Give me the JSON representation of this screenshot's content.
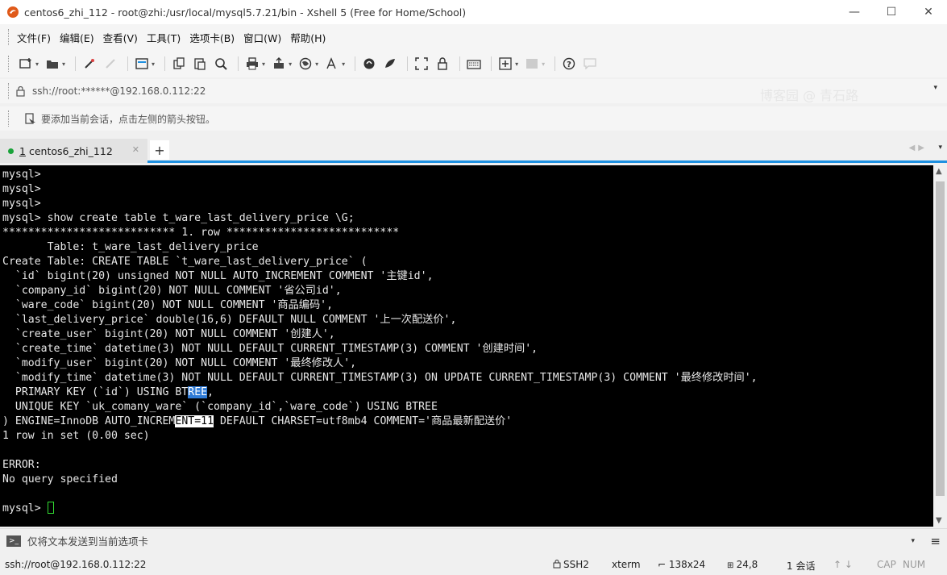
{
  "window": {
    "title": "centos6_zhi_112 - root@zhi:/usr/local/mysql5.7.21/bin - Xshell 5 (Free for Home/School)",
    "controls": {
      "minimize": "—",
      "maximize": "☐",
      "close": "✕"
    }
  },
  "menu": {
    "items": [
      "文件(F)",
      "编辑(E)",
      "查看(V)",
      "工具(T)",
      "选项卡(B)",
      "窗口(W)",
      "帮助(H)"
    ]
  },
  "address": {
    "value": "ssh://root:******@192.168.0.112:22",
    "watermark": "博客园 @ 青石路"
  },
  "hint": {
    "text": "要添加当前会话，点击左侧的箭头按钮。"
  },
  "tabs": {
    "active": {
      "number": "1",
      "label": "centos6_zhi_112"
    },
    "add": "+"
  },
  "terminal": {
    "lines": [
      "mysql>",
      "mysql>",
      "mysql>",
      "mysql> show create table t_ware_last_delivery_price \\G;",
      "*************************** 1. row ***************************",
      "       Table: t_ware_last_delivery_price",
      "Create Table: CREATE TABLE `t_ware_last_delivery_price` (",
      "  `id` bigint(20) unsigned NOT NULL AUTO_INCREMENT COMMENT '主键id',",
      "  `company_id` bigint(20) NOT NULL COMMENT '省公司id',",
      "  `ware_code` bigint(20) NOT NULL COMMENT '商品编码',",
      "  `last_delivery_price` double(16,6) DEFAULT NULL COMMENT '上一次配送价',",
      "  `create_user` bigint(20) NOT NULL COMMENT '创建人',",
      "  `create_time` datetime(3) NOT NULL DEFAULT CURRENT_TIMESTAMP(3) COMMENT '创建时间',",
      "  `modify_user` bigint(20) NOT NULL COMMENT '最终修改人',",
      "  `modify_time` datetime(3) NOT NULL DEFAULT CURRENT_TIMESTAMP(3) ON UPDATE CURRENT_TIMESTAMP(3) COMMENT '最终修改时间',",
      "  PRIMARY KEY (`id`) USING BTREE,",
      "  UNIQUE KEY `uk_comany_ware` (`company_id`,`ware_code`) USING BTREE",
      ") ENGINE=InnoDB AUTO_INCREMENT=11 DEFAULT CHARSET=utf8mb4 COMMENT='商品最新配送价'",
      "1 row in set (0.00 sec)",
      "",
      "ERROR:",
      "No query specified",
      "",
      "mysql> "
    ],
    "selection_primary_key": {
      "before": "  PRIMARY KEY (`id`) USING BT",
      "selected": "REE",
      "after": ","
    },
    "selection_engine": {
      "before": ") ENGINE=InnoDB AUTO_INCREM",
      "selected": "ENT=11",
      "after": " DEFAULT CHARSET=utf8mb4 COMMENT='商品最新配送价'"
    }
  },
  "compose": {
    "text": "仅将文本发送到当前选项卡"
  },
  "status": {
    "connection": "ssh://root@192.168.0.112:22",
    "protocol": "SSH2",
    "terminal": "xterm",
    "size": "138x24",
    "cursor": "24,8",
    "sessions": "1 会话",
    "caps": "CAP",
    "num": "NUM"
  },
  "colors": {
    "tab_accent": "#1e90e0",
    "tab_dot": "#1aa33a",
    "cursor": "#33dd33",
    "selection_blue": "#2f7bd6"
  }
}
